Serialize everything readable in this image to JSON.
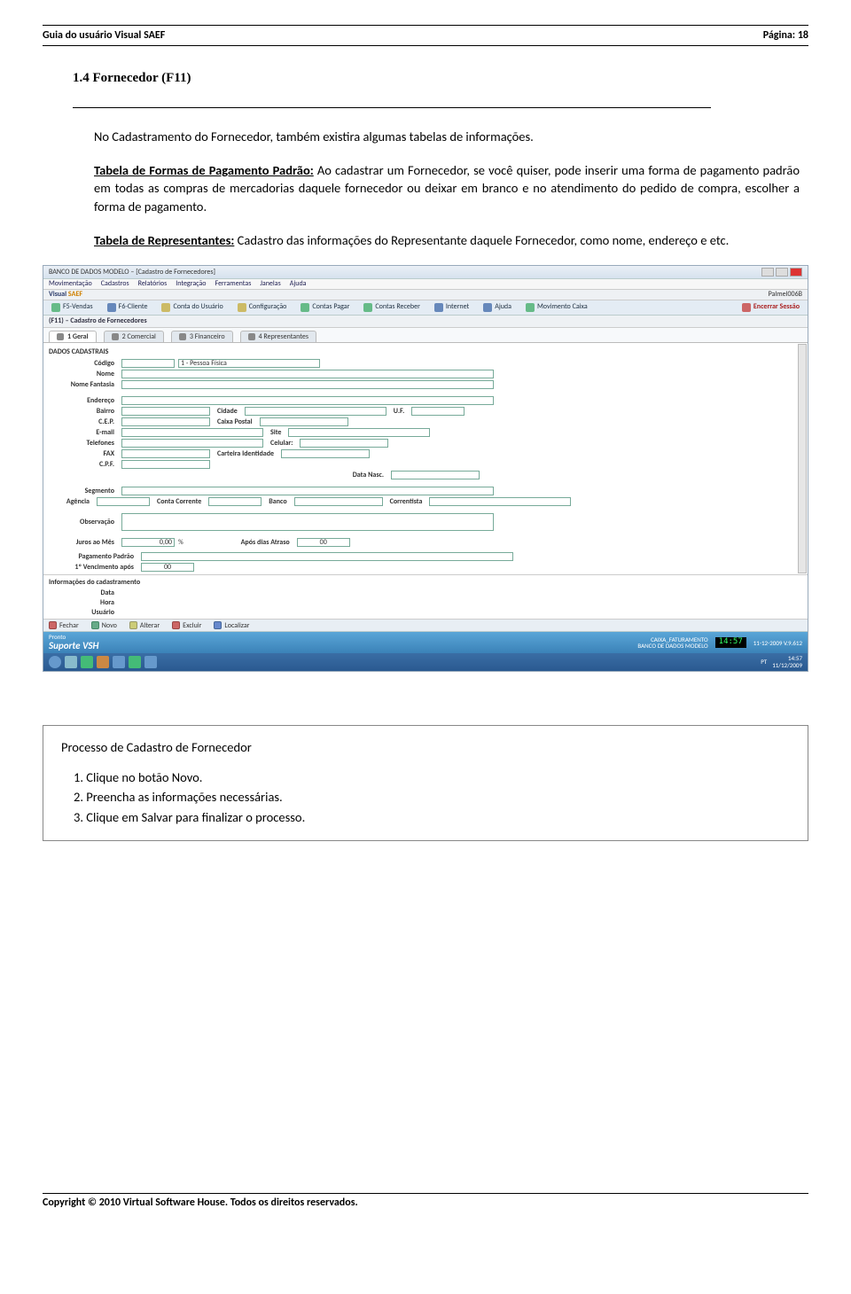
{
  "header": {
    "title_left": "Guia do usuário Visual SAEF",
    "title_right": "Página: 18"
  },
  "section_title": "1.4 Fornecedor (F11)",
  "intro": "No Cadastramento do Fornecedor, também existira algumas tabelas de informações.",
  "para_forms": {
    "lead": "Tabela de Formas de Pagamento Padrão:",
    "rest": " Ao cadastrar um Fornecedor, se você quiser, pode inserir uma forma de pagamento padrão em todas as compras de mercadorias daquele fornecedor ou deixar em branco e no atendimento do pedido de compra, escolher a forma de pagamento."
  },
  "para_reps": {
    "lead": "Tabela de Representantes:",
    "rest": " Cadastro das informações do Representante daquele Fornecedor, como nome, endereço e etc."
  },
  "screenshot": {
    "window_title": "BANCO DE DADOS MODELO – [Cadastro de Fornecedores]",
    "menubar": [
      "Movimentação",
      "Cadastros",
      "Relatórios",
      "Integração",
      "Ferramentas",
      "Janelas",
      "Ajuda"
    ],
    "brand": "Visual SAEF",
    "brand_right": "Palmel006B",
    "toolbar": [
      "F5-Vendas",
      "F6-Cliente",
      "Conta do Usuário",
      "Configuração",
      "Contas Pagar",
      "Contas Receber",
      "Internet",
      "Ajuda",
      "Movimento Caixa",
      "Encerrar Sessão"
    ],
    "subtitle": "(F11) – Cadastro de Fornecedores",
    "tabs": [
      "1 Geral",
      "2 Comercial",
      "3 Financeiro",
      "4 Representantes"
    ],
    "dados_label": "DADOS CADASTRAIS",
    "fields": {
      "codigo": "Código",
      "codigo_desc": "1 - Pessoa Física",
      "nome": "Nome",
      "fantasia": "Nome Fantasia",
      "endereco": "Endereço",
      "bairro": "Bairro",
      "cidade": "Cidade",
      "uf": "U.F.",
      "cep": "C.E.P.",
      "caixapostal": "Caixa Postal",
      "email": "E-mail",
      "site": "Site",
      "telefones": "Telefones",
      "celular": "Celular:",
      "fax": "FAX",
      "carteira": "Carteira Identidade",
      "cpf": "C.P.F.",
      "datanasc": "Data Nasc.",
      "segmento": "Segmento",
      "agencia": "Agência",
      "contacorrente": "Conta Corrente",
      "banco": "Banco",
      "correntista": "Correntista",
      "observacao": "Observação",
      "jurosmes": "Juros ao Mês",
      "juros_val": "0,00",
      "percent": "%",
      "aposdias": "Após dias Atraso",
      "aposdias_val": "00",
      "pagpadrao": "Pagamento Padrão",
      "venc": "1º Vencimento após",
      "venc_val": "00"
    },
    "infocad": {
      "label": "Informações do cadastramento",
      "data": "Data",
      "hora": "Hora",
      "usuario": "Usuário"
    },
    "bottom": [
      "Fechar",
      "Novo",
      "Alterar",
      "Excluir",
      "Localizar"
    ],
    "status": {
      "left": "Pronto",
      "l2": "Suporte VSH",
      "r1": "CAIXA_FATURAMENTO",
      "r2": "BANCO DE DADOS MODELO",
      "clock": "14:57",
      "date": "11-12-2009  V.9.612"
    },
    "taskbar": {
      "tray": "PT",
      "tray_time": "14:57",
      "tray_date": "11/12/2009"
    }
  },
  "steps": {
    "heading": "Processo de Cadastro de Fornecedor",
    "s1": "1.  Clique no botão Novo.",
    "s2": "2.  Preencha as informações necessárias.",
    "s3": "3.  Clique em Salvar para finalizar o processo."
  },
  "footer": "Copyright © 2010 Virtual Software House. Todos os direitos reservados."
}
